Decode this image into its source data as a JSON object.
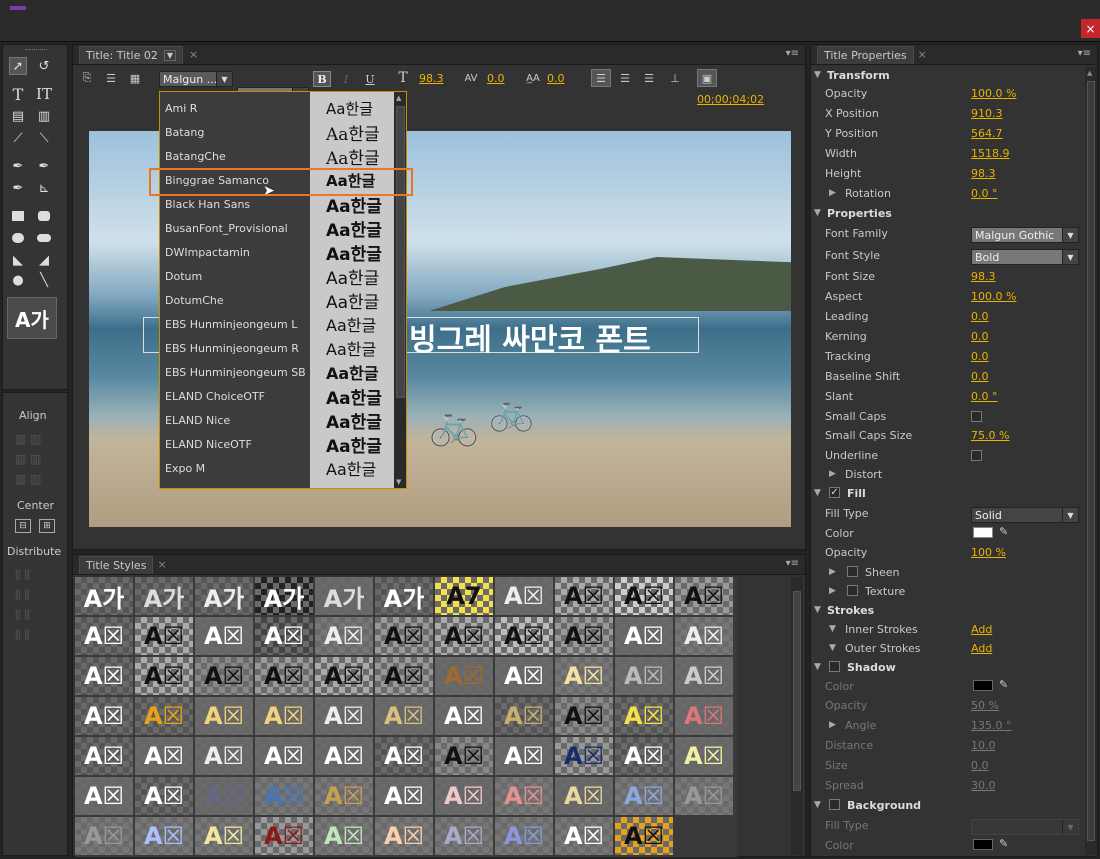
{
  "title_panel": {
    "tab_label": "Title: Title 02",
    "font_family_short": "Malgun ...",
    "font_style": "Bold",
    "bold_btn": "B",
    "italic_btn": "I",
    "underline_btn": "U",
    "size_value": "98.3",
    "kerning_value": "0.0",
    "leading_value": "0.0",
    "timecode": "00;00;04;02",
    "canvas_text": "빙그레 싸만코 폰트"
  },
  "font_list": [
    {
      "name": "Ami R",
      "preview": "Aa한글"
    },
    {
      "name": "Batang",
      "preview": "Aa한글"
    },
    {
      "name": "BatangChe",
      "preview": "Aa한글"
    },
    {
      "name": "Binggrae Samanco",
      "preview": "Aa한글"
    },
    {
      "name": "Black Han Sans",
      "preview": "Aa한글"
    },
    {
      "name": "BusanFont_Provisional",
      "preview": "Aa한글"
    },
    {
      "name": "DWImpactamin",
      "preview": "Aa한글"
    },
    {
      "name": "Dotum",
      "preview": "Aa한글"
    },
    {
      "name": "DotumChe",
      "preview": "Aa한글"
    },
    {
      "name": "EBS Hunminjeongeum L",
      "preview": "Aa한글"
    },
    {
      "name": "EBS Hunminjeongeum R",
      "preview": "Aa한글"
    },
    {
      "name": "EBS Hunminjeongeum SB",
      "preview": "Aa한글"
    },
    {
      "name": "ELAND ChoiceOTF",
      "preview": "Aa한글"
    },
    {
      "name": "ELAND Nice",
      "preview": "Aa한글"
    },
    {
      "name": "ELAND NiceOTF",
      "preview": "Aa한글"
    },
    {
      "name": "Expo M",
      "preview": "Aa한글"
    }
  ],
  "tools": {
    "align_label": "Align",
    "center_label": "Center",
    "distribute_label": "Distribute",
    "style_preview": "A가"
  },
  "styles_panel": {
    "tab_label": "Title Styles"
  },
  "props_panel": {
    "tab_label": "Title Properties",
    "transform": "Transform",
    "opacity_label": "Opacity",
    "opacity": "100.0 %",
    "xpos_label": "X Position",
    "xpos": "910.3",
    "ypos_label": "Y Position",
    "ypos": "564.7",
    "width_label": "Width",
    "width": "1518.9",
    "height_label": "Height",
    "height": "98.3",
    "rotation_label": "Rotation",
    "rotation": "0.0 °",
    "properties": "Properties",
    "font_family_label": "Font Family",
    "font_family": "Malgun Gothic",
    "font_style_label": "Font Style",
    "font_style": "Bold",
    "font_size_label": "Font Size",
    "font_size": "98.3",
    "aspect_label": "Aspect",
    "aspect": "100.0 %",
    "leading_label": "Leading",
    "leading": "0.0",
    "kerning_label": "Kerning",
    "kerning": "0.0",
    "tracking_label": "Tracking",
    "tracking": "0.0",
    "baseline_label": "Baseline Shift",
    "baseline": "0.0",
    "slant_label": "Slant",
    "slant": "0.0 °",
    "smallcaps_label": "Small Caps",
    "smallcaps_size_label": "Small Caps Size",
    "smallcaps_size": "75.0 %",
    "underline_label": "Underline",
    "distort_label": "Distort",
    "fill": "Fill",
    "fill_type_label": "Fill Type",
    "fill_type": "Solid",
    "color_label": "Color",
    "fill_opacity_label": "Opacity",
    "fill_opacity": "100 %",
    "sheen_label": "Sheen",
    "texture_label": "Texture",
    "strokes": "Strokes",
    "inner_label": "Inner Strokes",
    "outer_label": "Outer Strokes",
    "add": "Add",
    "shadow": "Shadow",
    "sh_color_label": "Color",
    "sh_opacity_label": "Opacity",
    "sh_opacity": "50 %",
    "sh_angle_label": "Angle",
    "sh_angle": "135.0 °",
    "sh_distance_label": "Distance",
    "sh_distance": "10.0",
    "sh_size_label": "Size",
    "sh_size": "0.0",
    "sh_spread_label": "Spread",
    "sh_spread": "30.0",
    "background": "Background",
    "bg_fill_label": "Fill Type",
    "bg_color_label": "Color"
  },
  "colors": {
    "accent": "#e8b400",
    "highlight": "#e87722",
    "close": "#c1272d"
  }
}
